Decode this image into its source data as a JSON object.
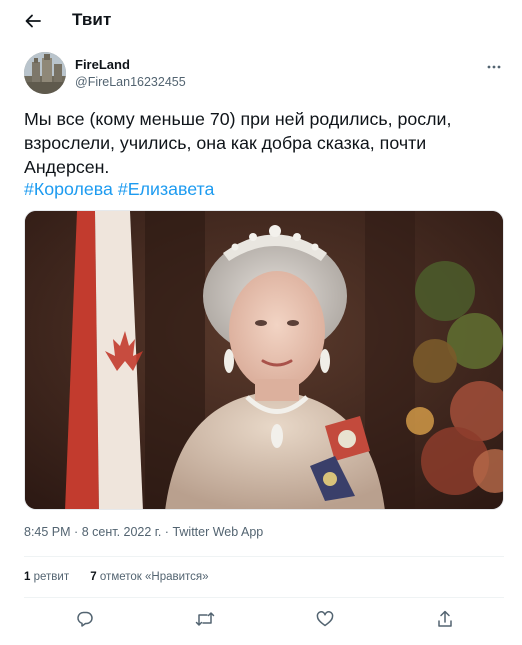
{
  "header": {
    "back_icon": "arrow-left-icon",
    "title": "Твит"
  },
  "tweet": {
    "author": {
      "display_name": "FireLand",
      "handle": "@FireLan16232455"
    },
    "more_icon": "more-horizontal-icon",
    "text_lines": [
      "Мы все (кому меньше 70) при ней родились, росли,",
      "взрослели, учились, она как добра сказка, почти",
      "Андерсен."
    ],
    "hashtags": [
      "#Королева",
      "#Елизавета"
    ],
    "time": "8:45 PM",
    "date": "8 сент. 2022 г.",
    "separator": "·",
    "source": "Twitter Web App",
    "stats": {
      "retweets_count": "1",
      "retweets_label": "ретвит",
      "likes_count": "7",
      "likes_label": "отметок «Нравится»"
    },
    "actions": [
      "reply-icon",
      "retweet-icon",
      "like-icon",
      "share-icon"
    ]
  },
  "colors": {
    "text": "#0f1419",
    "secondary": "#536471",
    "link": "#1d9bf0",
    "divider": "#eff3f4"
  }
}
